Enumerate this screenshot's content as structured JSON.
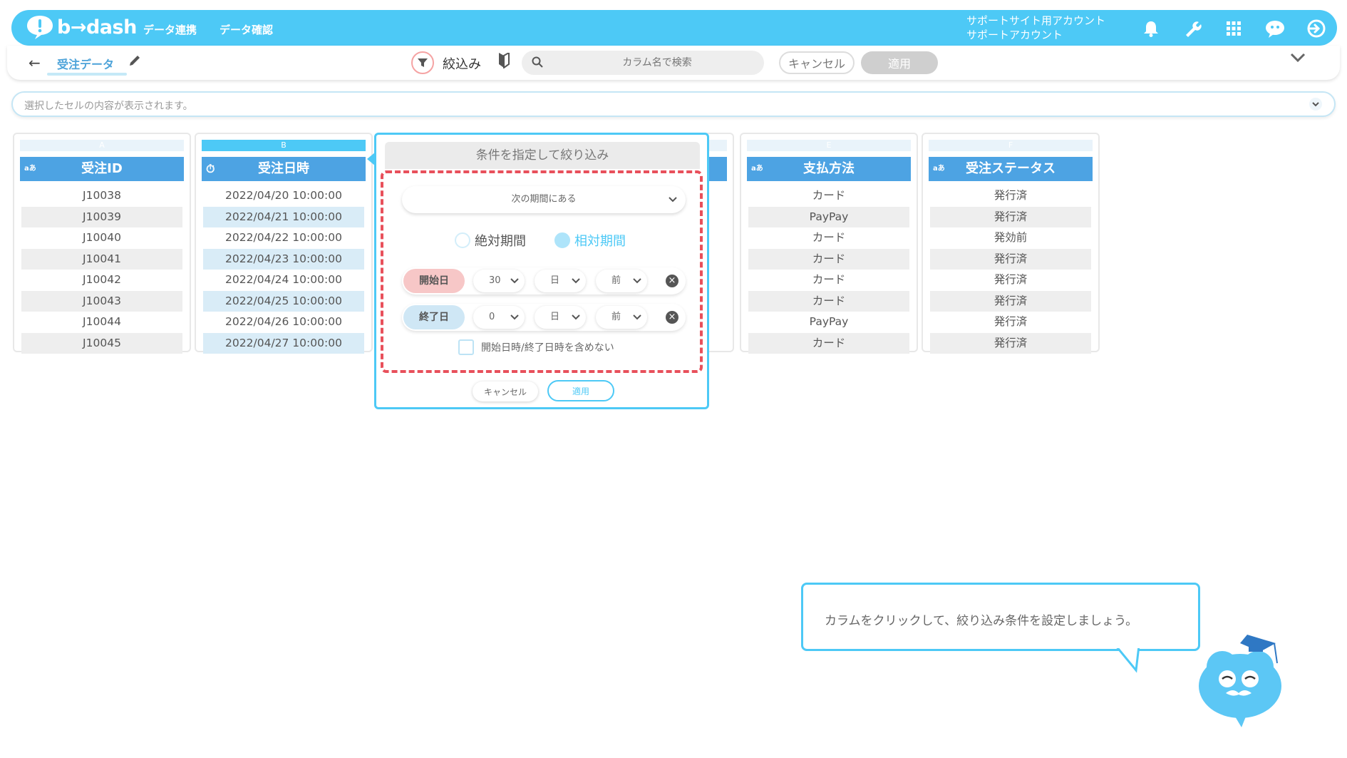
{
  "header": {
    "logo_text": "b→dash",
    "nav": [
      "データ連携",
      "データ確認"
    ],
    "account_line1": "サポートサイト用アカウント",
    "account_line2": "サポートアカウント",
    "icons": [
      "bell-icon",
      "wrench-icon",
      "apps-grid-icon",
      "chat-bot-icon",
      "logout-icon"
    ],
    "accent_color": "#4dc9f6"
  },
  "toolbar": {
    "back_label": "←",
    "title": "受注データ",
    "filter_label": "絞込み",
    "search_placeholder": "カラム名で検索",
    "cancel_label": "キャンセル",
    "apply_label": "適用"
  },
  "cell_bar": {
    "placeholder": "選択したセルの内容が表示されます。"
  },
  "columns": [
    {
      "letter": "A",
      "type_icon": "aあ",
      "name": "受注ID",
      "cells": [
        "J10038",
        "J10039",
        "J10040",
        "J10041",
        "J10042",
        "J10043",
        "J10044",
        "J10045"
      ]
    },
    {
      "letter": "B",
      "type_icon": "⏱",
      "name": "受注日時",
      "cells": [
        "2022/04/20 10:00:00",
        "2022/04/21 10:00:00",
        "2022/04/22 10:00:00",
        "2022/04/23 10:00:00",
        "2022/04/24 10:00:00",
        "2022/04/25 10:00:00",
        "2022/04/26 10:00:00",
        "2022/04/27 10:00:00"
      ]
    },
    {
      "letter": "E",
      "type_icon": "aあ",
      "name": "支払方法",
      "cells": [
        "カード",
        "PayPay",
        "カード",
        "カード",
        "カード",
        "カード",
        "PayPay",
        "カード"
      ]
    },
    {
      "letter": "F",
      "type_icon": "aあ",
      "name": "受注ステータス",
      "cells": [
        "発行済",
        "発行済",
        "発効前",
        "発行済",
        "発行済",
        "発行済",
        "発行済",
        "発行済"
      ]
    }
  ],
  "filter_popup": {
    "title": "条件を指定して絞り込み",
    "condition": "次の期間にある",
    "radio_absolute": "絶対期間",
    "radio_relative": "相対期間",
    "selected_mode": "相対期間",
    "start": {
      "label": "開始日",
      "amount": "30",
      "unit": "日",
      "direction": "前"
    },
    "end": {
      "label": "終了日",
      "amount": "0",
      "unit": "日",
      "direction": "前"
    },
    "exclude_label": "開始日時/終了日時を含めない",
    "cancel_label": "キャンセル",
    "apply_label": "適用",
    "highlight_color": "#e8505b"
  },
  "tutorial": {
    "message": "カラムをクリックして、絞り込み条件を設定しましょう。"
  }
}
